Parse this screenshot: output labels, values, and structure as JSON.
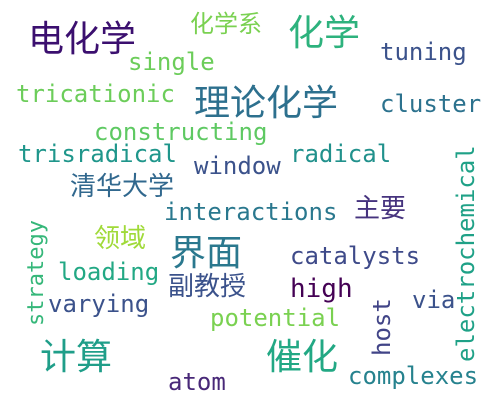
{
  "words": [
    {
      "text": "电化学",
      "color": "#3b0f6f"
    },
    {
      "text": "化学系",
      "color": "#7ad151"
    },
    {
      "text": "化学",
      "color": "#2db27d"
    },
    {
      "text": "single",
      "color": "#6ccd5a"
    },
    {
      "text": "tuning",
      "color": "#3b528b"
    },
    {
      "text": "tricationic",
      "color": "#6ccd5a"
    },
    {
      "text": "理论化学",
      "color": "#2d708e"
    },
    {
      "text": "cluster",
      "color": "#2c728e"
    },
    {
      "text": "constructing",
      "color": "#5ec962"
    },
    {
      "text": "trisradical",
      "color": "#1f968b"
    },
    {
      "text": "window",
      "color": "#3b528b"
    },
    {
      "text": "radical",
      "color": "#21918c"
    },
    {
      "text": "清华大学",
      "color": "#31688e"
    },
    {
      "text": "interactions",
      "color": "#2a788e"
    },
    {
      "text": "主要",
      "color": "#46337e"
    },
    {
      "text": "领域",
      "color": "#a0da39"
    },
    {
      "text": "界面",
      "color": "#2a788e"
    },
    {
      "text": "catalysts",
      "color": "#3e4a89"
    },
    {
      "text": "loading",
      "color": "#22a884"
    },
    {
      "text": "副教授",
      "color": "#3b528b"
    },
    {
      "text": "high",
      "color": "#440154"
    },
    {
      "text": "via",
      "color": "#3b528b"
    },
    {
      "text": "varying",
      "color": "#3b528b"
    },
    {
      "text": "potential",
      "color": "#7ad151"
    },
    {
      "text": "计算",
      "color": "#1f9e89"
    },
    {
      "text": "催化",
      "color": "#22a884"
    },
    {
      "text": "atom",
      "color": "#482878"
    },
    {
      "text": "complexes",
      "color": "#26828e"
    },
    {
      "text": "strategy",
      "color": "#35b779"
    },
    {
      "text": "host",
      "color": "#414487"
    },
    {
      "text": "electrochemical",
      "color": "#1fa187"
    }
  ]
}
